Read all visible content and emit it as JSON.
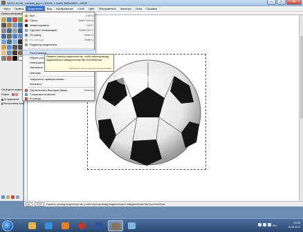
{
  "window": {
    "title": "*[2011-12-28_ combat(.jpg-1.0 (RGB, 1 слой) 3985x3985 – GIMP"
  },
  "menubar": {
    "items": [
      "Файл",
      "Правка",
      "Выделение",
      "Вид",
      "Изображение",
      "Слой",
      "Цвет",
      "Инструменты",
      "Фильтры",
      "Окна",
      "Справка"
    ],
    "active": "Выделение"
  },
  "toolbox": {
    "header": "Панель инструментов",
    "options_label": "Свободное выделение",
    "mode_label": "Режим:",
    "antialias_label": "Сглаживание",
    "feather_label": "Растушевать края"
  },
  "select_menu": {
    "items": [
      {
        "label": "Всё",
        "shortcut": "Ctrl+A"
      },
      {
        "label": "Снять",
        "shortcut": "Shift+Ctrl+A"
      },
      {
        "label": "Инвертировать",
        "shortcut": "Ctrl+I"
      },
      {
        "label": "Сделать плавающим",
        "shortcut": "Shift+Ctrl+L"
      },
      {
        "label": "По цвету",
        "shortcut": "Shift+O"
      },
      {
        "label": "Из контура",
        "shortcut": "Shift+V"
      },
      {
        "label": "Редактор выделения",
        "shortcut": ""
      },
      {
        "label": "Растушевать...",
        "shortcut": ""
      },
      {
        "label": "Убрать растушевку...",
        "shortcut": ""
      },
      {
        "label": "Уменьшить...",
        "shortcut": ""
      },
      {
        "label": "Увеличить...",
        "shortcut": ""
      },
      {
        "label": "Граница...",
        "shortcut": ""
      },
      {
        "label": "Закруглить прямоугольник...",
        "shortcut": ""
      },
      {
        "label": "Исказить...",
        "shortcut": ""
      },
      {
        "label": "Переключить быструю маску",
        "shortcut": "Shift+Q"
      },
      {
        "label": "Сохранить в канале",
        "shortcut": ""
      },
      {
        "label": "В контур",
        "shortcut": ""
      }
    ],
    "highlighted": "Растушевать..."
  },
  "tooltip": {
    "text": "Размыть границу выделения так, чтобы переход между выделенным и невыделенным был постепенным",
    "hint": "Нажмите F1 для получения полной справки"
  },
  "statusbar": {
    "unit": "px",
    "zoom": "3.1%",
    "message": "Размыть границу выделения так, чтобы переход между выделенным и невыделенным был постепенным"
  },
  "taskbar": {
    "lang": "RU",
    "time": "13:30",
    "date": "31.03.2014"
  },
  "colors": {
    "accent": "#3a6fc4",
    "menu_highlight": "#d6e4f7",
    "tooltip_bg": "#ffffdf",
    "taskbar": "#2c4a72"
  },
  "icons": [
    "start-orb-icon",
    "explorer-icon",
    "media-player-icon",
    "firefox-icon",
    "opera-icon",
    "word-icon",
    "gimp-icon",
    "paint-icon"
  ]
}
